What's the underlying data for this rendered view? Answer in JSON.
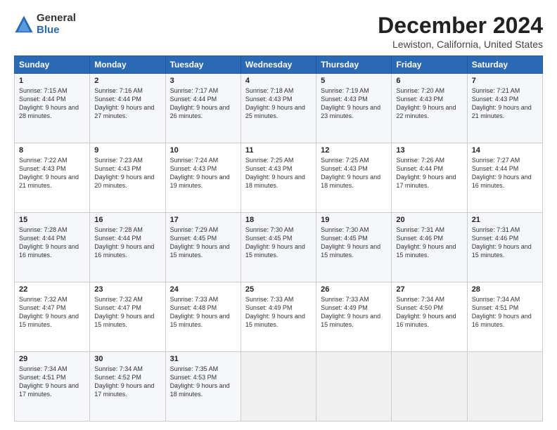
{
  "logo": {
    "general": "General",
    "blue": "Blue"
  },
  "title": "December 2024",
  "subtitle": "Lewiston, California, United States",
  "calendar": {
    "headers": [
      "Sunday",
      "Monday",
      "Tuesday",
      "Wednesday",
      "Thursday",
      "Friday",
      "Saturday"
    ],
    "weeks": [
      [
        null,
        {
          "day": 2,
          "sunrise": "7:16 AM",
          "sunset": "4:44 PM",
          "daylight": "9 hours and 27 minutes."
        },
        {
          "day": 3,
          "sunrise": "7:17 AM",
          "sunset": "4:44 PM",
          "daylight": "9 hours and 26 minutes."
        },
        {
          "day": 4,
          "sunrise": "7:18 AM",
          "sunset": "4:43 PM",
          "daylight": "9 hours and 25 minutes."
        },
        {
          "day": 5,
          "sunrise": "7:19 AM",
          "sunset": "4:43 PM",
          "daylight": "9 hours and 23 minutes."
        },
        {
          "day": 6,
          "sunrise": "7:20 AM",
          "sunset": "4:43 PM",
          "daylight": "9 hours and 22 minutes."
        },
        {
          "day": 7,
          "sunrise": "7:21 AM",
          "sunset": "4:43 PM",
          "daylight": "9 hours and 21 minutes."
        }
      ],
      [
        {
          "day": 1,
          "sunrise": "7:15 AM",
          "sunset": "4:44 PM",
          "daylight": "9 hours and 28 minutes."
        },
        null,
        null,
        null,
        null,
        null,
        null
      ],
      [
        {
          "day": 8,
          "sunrise": "7:22 AM",
          "sunset": "4:43 PM",
          "daylight": "9 hours and 21 minutes."
        },
        {
          "day": 9,
          "sunrise": "7:23 AM",
          "sunset": "4:43 PM",
          "daylight": "9 hours and 20 minutes."
        },
        {
          "day": 10,
          "sunrise": "7:24 AM",
          "sunset": "4:43 PM",
          "daylight": "9 hours and 19 minutes."
        },
        {
          "day": 11,
          "sunrise": "7:25 AM",
          "sunset": "4:43 PM",
          "daylight": "9 hours and 18 minutes."
        },
        {
          "day": 12,
          "sunrise": "7:25 AM",
          "sunset": "4:43 PM",
          "daylight": "9 hours and 18 minutes."
        },
        {
          "day": 13,
          "sunrise": "7:26 AM",
          "sunset": "4:44 PM",
          "daylight": "9 hours and 17 minutes."
        },
        {
          "day": 14,
          "sunrise": "7:27 AM",
          "sunset": "4:44 PM",
          "daylight": "9 hours and 16 minutes."
        }
      ],
      [
        {
          "day": 15,
          "sunrise": "7:28 AM",
          "sunset": "4:44 PM",
          "daylight": "9 hours and 16 minutes."
        },
        {
          "day": 16,
          "sunrise": "7:28 AM",
          "sunset": "4:44 PM",
          "daylight": "9 hours and 16 minutes."
        },
        {
          "day": 17,
          "sunrise": "7:29 AM",
          "sunset": "4:45 PM",
          "daylight": "9 hours and 15 minutes."
        },
        {
          "day": 18,
          "sunrise": "7:30 AM",
          "sunset": "4:45 PM",
          "daylight": "9 hours and 15 minutes."
        },
        {
          "day": 19,
          "sunrise": "7:30 AM",
          "sunset": "4:45 PM",
          "daylight": "9 hours and 15 minutes."
        },
        {
          "day": 20,
          "sunrise": "7:31 AM",
          "sunset": "4:46 PM",
          "daylight": "9 hours and 15 minutes."
        },
        {
          "day": 21,
          "sunrise": "7:31 AM",
          "sunset": "4:46 PM",
          "daylight": "9 hours and 15 minutes."
        }
      ],
      [
        {
          "day": 22,
          "sunrise": "7:32 AM",
          "sunset": "4:47 PM",
          "daylight": "9 hours and 15 minutes."
        },
        {
          "day": 23,
          "sunrise": "7:32 AM",
          "sunset": "4:47 PM",
          "daylight": "9 hours and 15 minutes."
        },
        {
          "day": 24,
          "sunrise": "7:33 AM",
          "sunset": "4:48 PM",
          "daylight": "9 hours and 15 minutes."
        },
        {
          "day": 25,
          "sunrise": "7:33 AM",
          "sunset": "4:49 PM",
          "daylight": "9 hours and 15 minutes."
        },
        {
          "day": 26,
          "sunrise": "7:33 AM",
          "sunset": "4:49 PM",
          "daylight": "9 hours and 15 minutes."
        },
        {
          "day": 27,
          "sunrise": "7:34 AM",
          "sunset": "4:50 PM",
          "daylight": "9 hours and 16 minutes."
        },
        {
          "day": 28,
          "sunrise": "7:34 AM",
          "sunset": "4:51 PM",
          "daylight": "9 hours and 16 minutes."
        }
      ],
      [
        {
          "day": 29,
          "sunrise": "7:34 AM",
          "sunset": "4:51 PM",
          "daylight": "9 hours and 17 minutes."
        },
        {
          "day": 30,
          "sunrise": "7:34 AM",
          "sunset": "4:52 PM",
          "daylight": "9 hours and 17 minutes."
        },
        {
          "day": 31,
          "sunrise": "7:35 AM",
          "sunset": "4:53 PM",
          "daylight": "9 hours and 18 minutes."
        },
        null,
        null,
        null,
        null
      ]
    ]
  }
}
